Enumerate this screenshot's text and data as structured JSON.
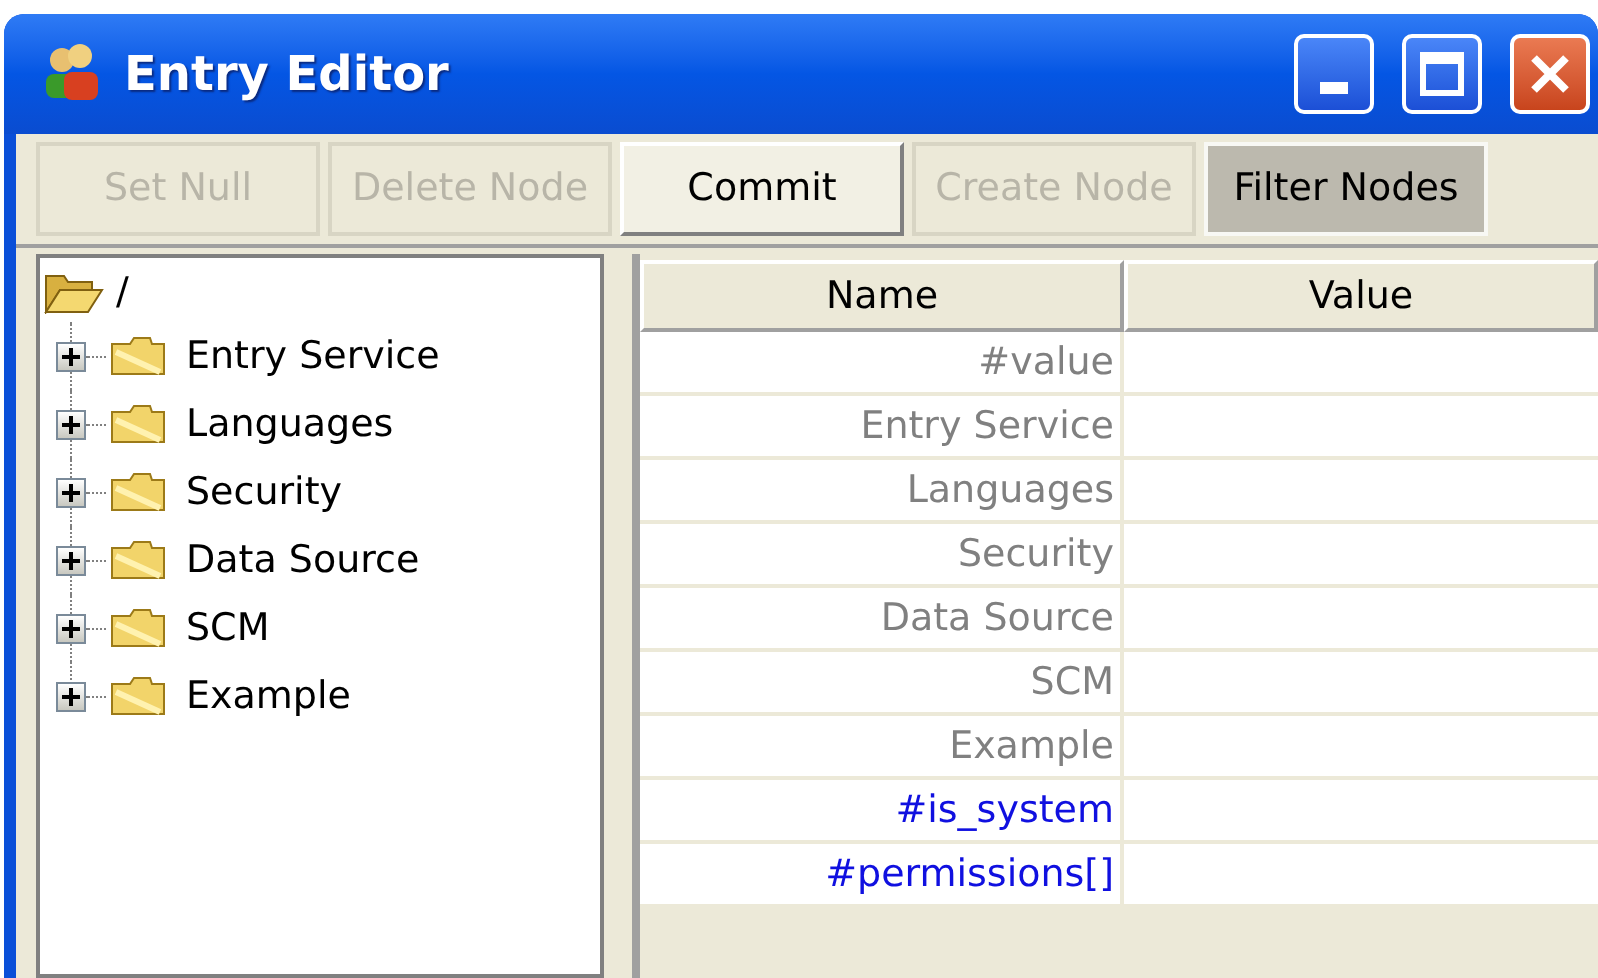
{
  "window": {
    "title": "Entry Editor"
  },
  "toolbar": [
    {
      "label": "Set Null",
      "disabled": true,
      "selected": false
    },
    {
      "label": "Delete Node",
      "disabled": true,
      "selected": false
    },
    {
      "label": "Commit",
      "disabled": false,
      "selected": false
    },
    {
      "label": "Create Node",
      "disabled": true,
      "selected": false
    },
    {
      "label": "Filter Nodes",
      "disabled": false,
      "selected": true
    }
  ],
  "tree": {
    "label": "/",
    "expanded": true,
    "children": [
      {
        "label": "Entry Service",
        "expanded": false
      },
      {
        "label": "Languages",
        "expanded": false
      },
      {
        "label": "Security",
        "expanded": false
      },
      {
        "label": "Data Source",
        "expanded": false
      },
      {
        "label": "SCM",
        "expanded": false
      },
      {
        "label": "Example",
        "expanded": false
      }
    ]
  },
  "table": {
    "columns": [
      "Name",
      "Value"
    ],
    "rows": [
      {
        "name": "#value",
        "kind": "node"
      },
      {
        "name": "Entry Service",
        "kind": "node"
      },
      {
        "name": "Languages",
        "kind": "node"
      },
      {
        "name": "Security",
        "kind": "node"
      },
      {
        "name": "Data Source",
        "kind": "node"
      },
      {
        "name": "SCM",
        "kind": "node"
      },
      {
        "name": "Example",
        "kind": "node"
      },
      {
        "name": "#is_system",
        "kind": "system"
      },
      {
        "name": "#permissions[]",
        "kind": "system"
      }
    ]
  }
}
